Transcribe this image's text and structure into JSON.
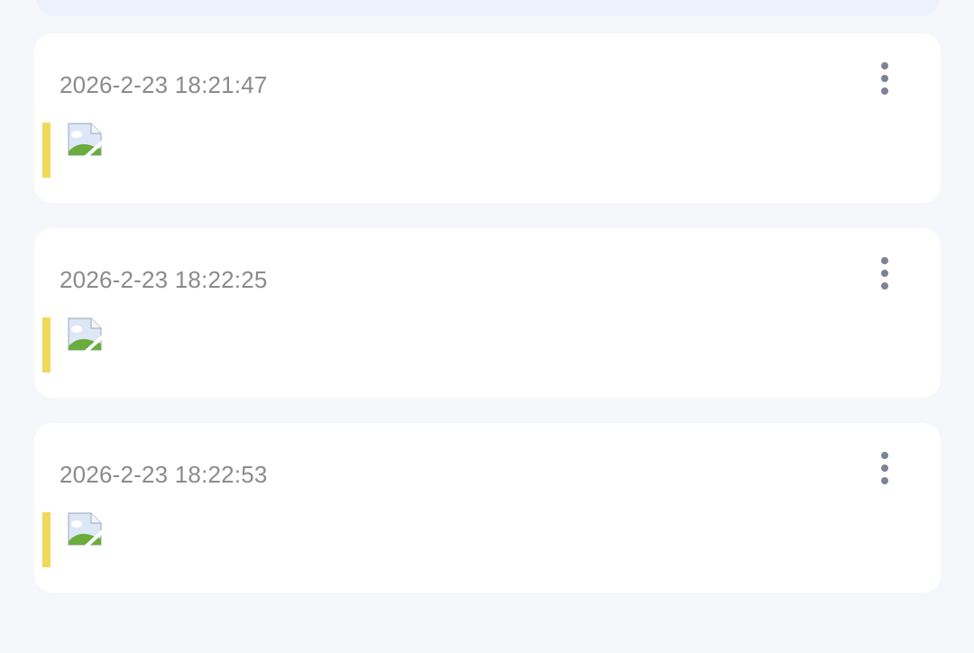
{
  "theme": {
    "page_background": "#f6f7fb",
    "card_background": "#ffffff",
    "accent_bar": "#f0d95c",
    "time_text": "#8a8b8f",
    "menu_icon": "#7c8394"
  },
  "notes": [
    {
      "time": "2026-2-23 18:21:47",
      "content_icon": "broken-image-icon",
      "menu_icon": "more-vertical-icon"
    },
    {
      "time": "2026-2-23 18:22:25",
      "content_icon": "broken-image-icon",
      "menu_icon": "more-vertical-icon"
    },
    {
      "time": "2026-2-23 18:22:53",
      "content_icon": "broken-image-icon",
      "menu_icon": "more-vertical-icon"
    }
  ]
}
